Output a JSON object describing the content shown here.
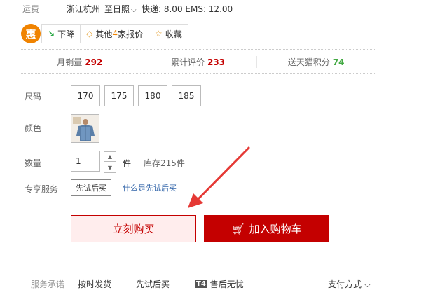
{
  "shipping": {
    "label": "运费",
    "origin": "浙江杭州",
    "destination": "至日照",
    "detail": "快递: 8.00 EMS: 12.00"
  },
  "promo": {
    "logo_char": "惠",
    "price_drop_label": "下降",
    "other_prefix": "其他",
    "other_count": "4",
    "other_suffix": "家报价",
    "favorite_label": "收藏"
  },
  "stats": [
    {
      "label": "月销量",
      "value": "292"
    },
    {
      "label": "累计评价",
      "value": "233"
    },
    {
      "label": "送天猫积分",
      "value": "74"
    }
  ],
  "size": {
    "label": "尺码",
    "options": [
      "170",
      "175",
      "180",
      "185"
    ]
  },
  "color": {
    "label": "颜色"
  },
  "quantity": {
    "label": "数量",
    "value": "1",
    "unit": "件",
    "stock": "库存215件"
  },
  "service": {
    "label": "专享服务",
    "button": "先试后买",
    "link": "什么是先试后买"
  },
  "actions": {
    "buy_now": "立刻购买",
    "add_to_cart": "加入购物车"
  },
  "footer": {
    "label": "服务承诺",
    "items": [
      "按时发货",
      "先试后买",
      "售后无忧"
    ],
    "t4_badge": "T4",
    "payment": "支付方式"
  },
  "colors": {
    "accent_red": "#c40000",
    "promo_orange": "#f08300",
    "points_green": "#44aa44",
    "arrow_red": "#e53935"
  }
}
